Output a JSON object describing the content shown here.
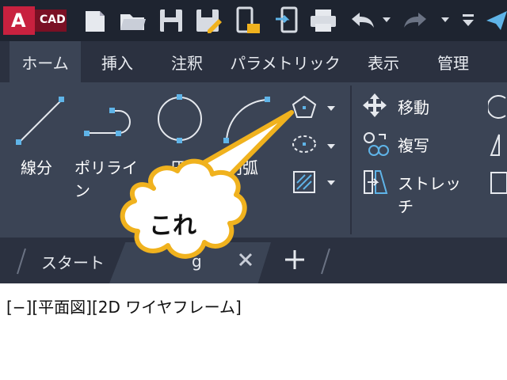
{
  "app": {
    "logo_letter": "A",
    "logo_text": "CAD"
  },
  "ribbon_tabs": [
    "ホーム",
    "挿入",
    "注釈",
    "パラメトリック",
    "表示",
    "管理"
  ],
  "draw_tools": {
    "line": "線分",
    "polyline": "ポリライン",
    "circle": "円",
    "arc": "円弧"
  },
  "modify_tools": {
    "move": "移動",
    "copy": "複写",
    "stretch": "ストレッチ"
  },
  "file_tabs": {
    "start": "スタート",
    "drawing": "g"
  },
  "viewport_label": "[−][平面図][2D ワイヤフレーム]",
  "callout_text": "これ",
  "colors": {
    "accent_red": "#c8213f",
    "accent_blue": "#5fb4e8",
    "callout_fill": "#ffffff",
    "callout_border": "#f0b21e"
  }
}
